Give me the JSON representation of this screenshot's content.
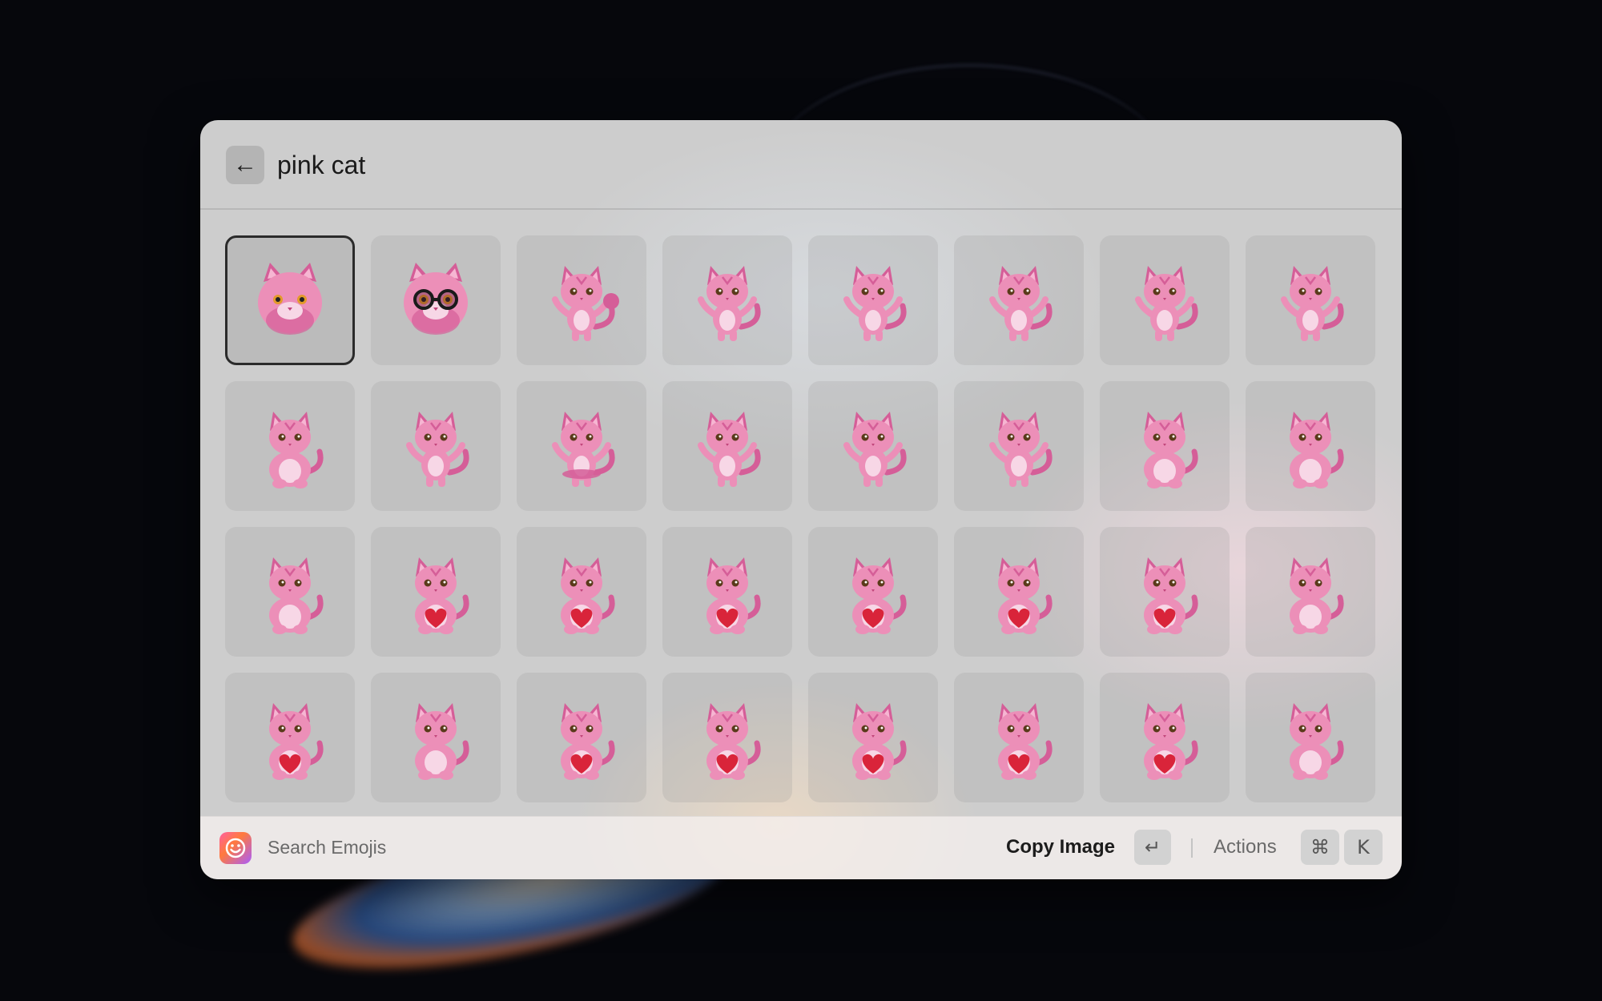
{
  "search": {
    "query": "pink cat",
    "back_icon": "arrow-left-icon"
  },
  "results": {
    "selected_index": 0,
    "items": [
      {
        "variant": "head",
        "accessory": "none"
      },
      {
        "variant": "head",
        "accessory": "glasses"
      },
      {
        "variant": "standing",
        "accessory": "pompom"
      },
      {
        "variant": "standing",
        "accessory": "none"
      },
      {
        "variant": "standing",
        "accessory": "none"
      },
      {
        "variant": "standing",
        "accessory": "none"
      },
      {
        "variant": "standing",
        "accessory": "none"
      },
      {
        "variant": "walking",
        "accessory": "none"
      },
      {
        "variant": "sitting",
        "accessory": "none"
      },
      {
        "variant": "standing",
        "accessory": "none"
      },
      {
        "variant": "standing",
        "accessory": "tutu"
      },
      {
        "variant": "standing",
        "accessory": "none"
      },
      {
        "variant": "standing",
        "accessory": "none"
      },
      {
        "variant": "standing",
        "accessory": "none"
      },
      {
        "variant": "sitting",
        "accessory": "none"
      },
      {
        "variant": "sitting",
        "accessory": "none"
      },
      {
        "variant": "sitting",
        "accessory": "none"
      },
      {
        "variant": "sitting",
        "accessory": "heart"
      },
      {
        "variant": "sitting",
        "accessory": "heart"
      },
      {
        "variant": "sitting",
        "accessory": "heart"
      },
      {
        "variant": "sitting",
        "accessory": "heart"
      },
      {
        "variant": "sitting",
        "accessory": "heart"
      },
      {
        "variant": "sitting",
        "accessory": "heart"
      },
      {
        "variant": "sitting",
        "accessory": "none"
      },
      {
        "variant": "sitting",
        "accessory": "heart"
      },
      {
        "variant": "sitting",
        "accessory": "none"
      },
      {
        "variant": "sitting",
        "accessory": "heart"
      },
      {
        "variant": "sitting",
        "accessory": "heart"
      },
      {
        "variant": "sitting",
        "accessory": "heart"
      },
      {
        "variant": "sitting",
        "accessory": "heart"
      },
      {
        "variant": "sitting",
        "accessory": "heart"
      },
      {
        "variant": "sitting",
        "accessory": "none"
      }
    ]
  },
  "footer": {
    "app_icon": "smiley-face-icon",
    "title": "Search Emojis",
    "primary_action": "Copy Image",
    "primary_shortcut": "↵",
    "actions_label": "Actions",
    "actions_shortcut": [
      "⌘",
      "K"
    ]
  },
  "colors": {
    "cat_fur": "#ec8fb8",
    "cat_fur_dark": "#d55e98",
    "cat_belly": "#f7d7e6",
    "heart": "#d9243a",
    "selection_border": "#2b2b2b"
  }
}
